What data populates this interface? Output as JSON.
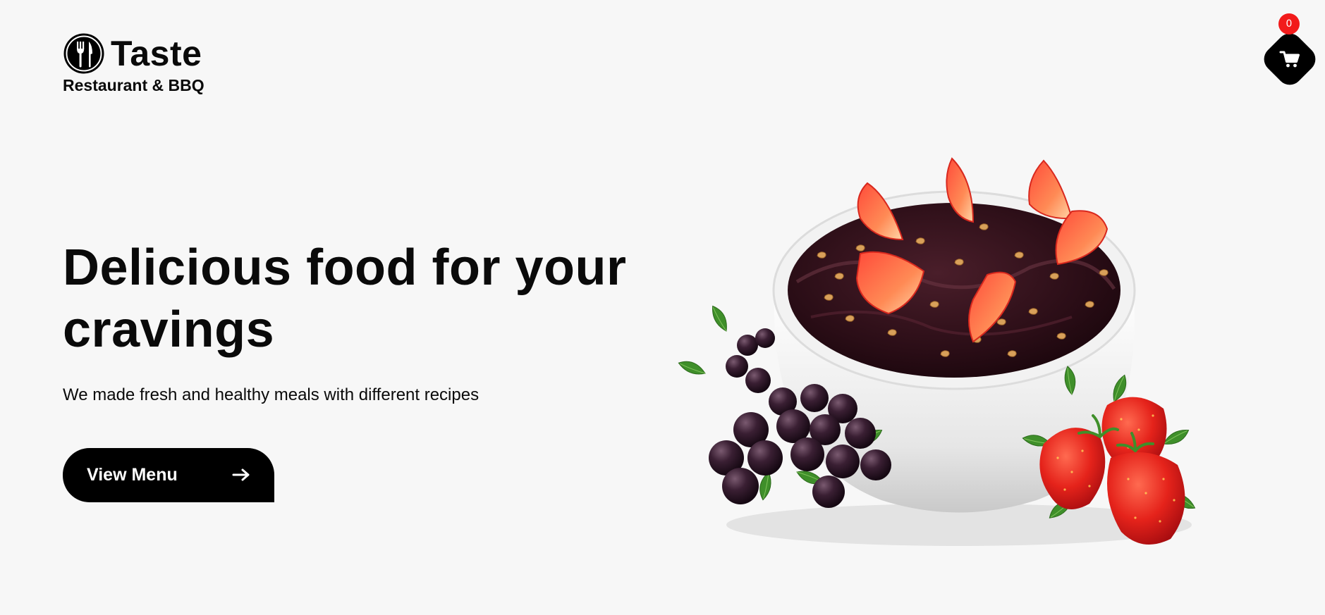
{
  "brand": {
    "name": "Taste",
    "tagline": "Restaurant & BBQ",
    "logo_icon": "fork-knife-icon"
  },
  "cart": {
    "icon": "cart-icon",
    "count": "0",
    "badge_color": "#f21b1b"
  },
  "hero": {
    "title": "Delicious food for your cravings",
    "subtitle": "We made fresh and healthy meals with different recipes",
    "cta_label": "View Menu",
    "cta_icon": "arrow-right-icon"
  },
  "colors": {
    "background": "#f7f7f7",
    "primary": "#000000"
  }
}
